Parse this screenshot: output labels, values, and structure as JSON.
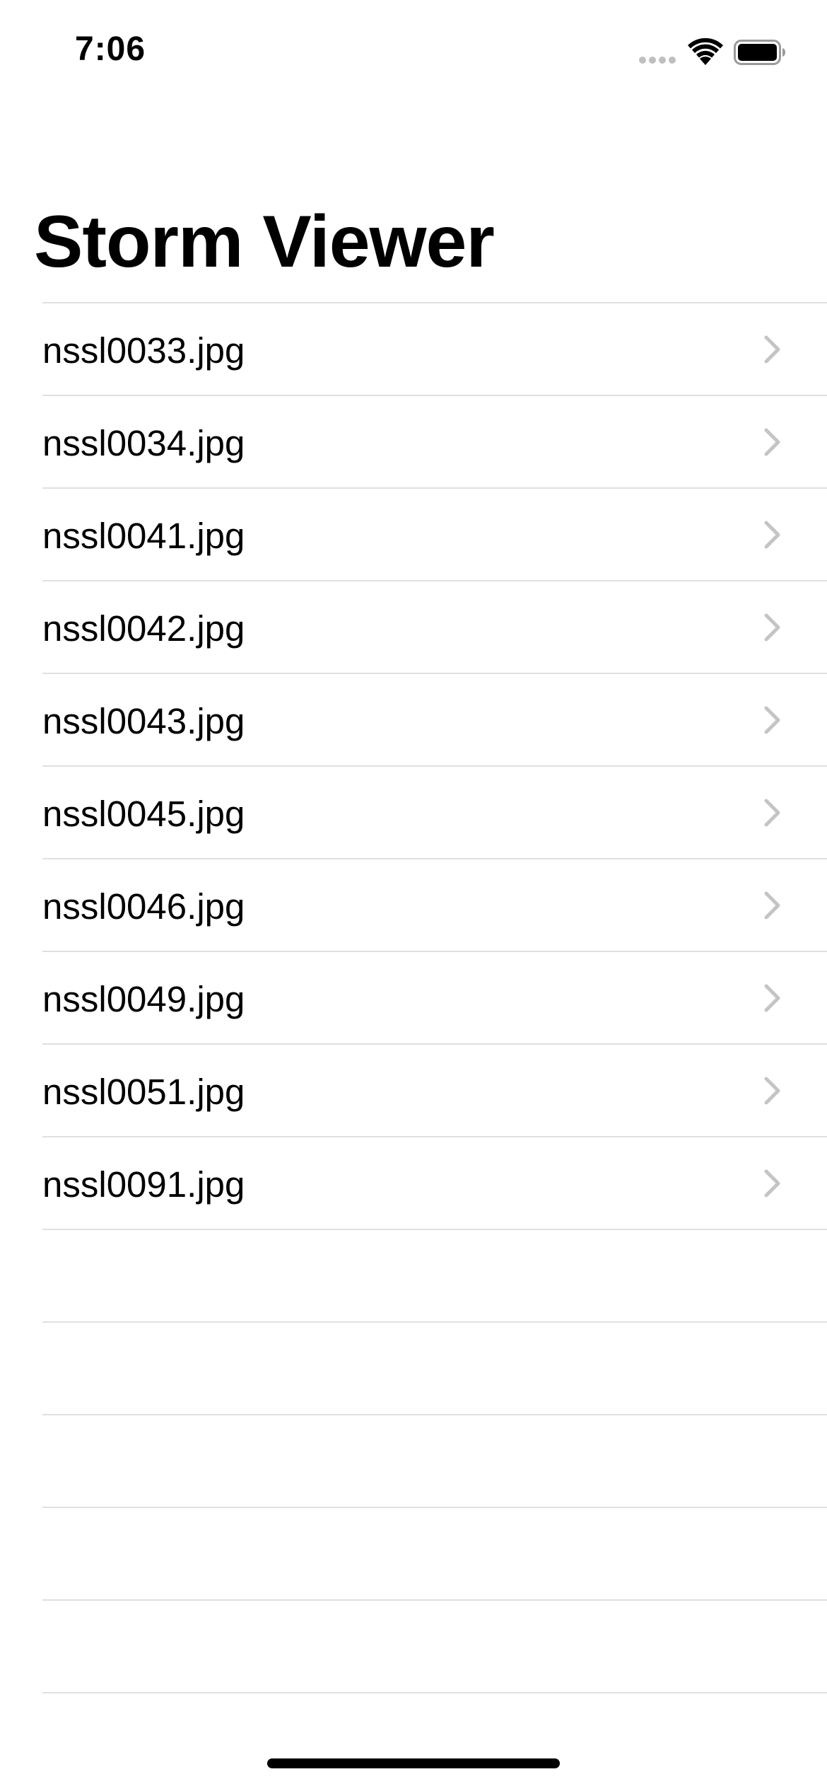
{
  "status_bar": {
    "time": "7:06",
    "signal_icon": "cellular-signal-icon",
    "wifi_icon": "wifi-icon",
    "battery_icon": "battery-icon"
  },
  "navigation": {
    "title": "Storm Viewer"
  },
  "table": {
    "rows": [
      {
        "label": "nssl0033.jpg",
        "accessory_icon": "chevron-right-icon"
      },
      {
        "label": "nssl0034.jpg",
        "accessory_icon": "chevron-right-icon"
      },
      {
        "label": "nssl0041.jpg",
        "accessory_icon": "chevron-right-icon"
      },
      {
        "label": "nssl0042.jpg",
        "accessory_icon": "chevron-right-icon"
      },
      {
        "label": "nssl0043.jpg",
        "accessory_icon": "chevron-right-icon"
      },
      {
        "label": "nssl0045.jpg",
        "accessory_icon": "chevron-right-icon"
      },
      {
        "label": "nssl0046.jpg",
        "accessory_icon": "chevron-right-icon"
      },
      {
        "label": "nssl0049.jpg",
        "accessory_icon": "chevron-right-icon"
      },
      {
        "label": "nssl0051.jpg",
        "accessory_icon": "chevron-right-icon"
      },
      {
        "label": "nssl0091.jpg",
        "accessory_icon": "chevron-right-icon"
      }
    ]
  },
  "colors": {
    "background": "#ffffff",
    "text": "#000000",
    "separator": "#e0e0e3",
    "chevron": "#c4c4c7"
  }
}
